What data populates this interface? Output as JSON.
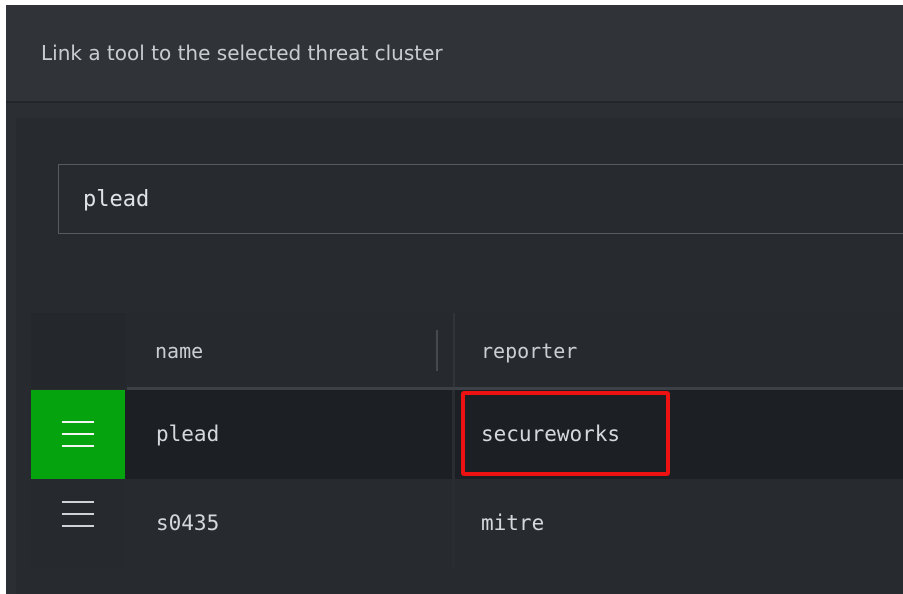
{
  "dialog": {
    "title": "Link a tool to the selected threat cluster"
  },
  "search": {
    "value": "plead",
    "placeholder": ""
  },
  "table": {
    "columns": {
      "name": "name",
      "reporter": "reporter"
    },
    "rows": [
      {
        "name": "plead",
        "reporter": "secureworks",
        "selected": true
      },
      {
        "name": "s0435",
        "reporter": "mitre",
        "selected": false
      }
    ]
  },
  "colors": {
    "selected_handle": "#05a40f",
    "highlight": "#ee1111",
    "background": "#2b2f34"
  },
  "icons": {
    "row_handle": "hamburger-icon"
  }
}
